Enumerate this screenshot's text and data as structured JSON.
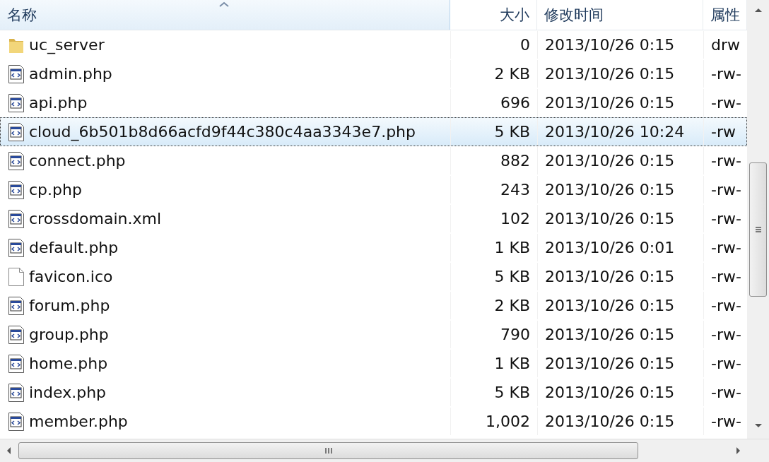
{
  "table": {
    "columns": [
      {
        "label": "名称",
        "sorted": true
      },
      {
        "label": "大小",
        "sorted": false
      },
      {
        "label": "修改时间",
        "sorted": false
      },
      {
        "label": "属性",
        "sorted": false
      }
    ],
    "rows": [
      {
        "kind": "folder",
        "name": "uc_server",
        "size": "0",
        "modified": "2013/10/26 0:15",
        "attributes": "drw",
        "selected": false
      },
      {
        "kind": "script",
        "name": "admin.php",
        "size": "2 KB",
        "modified": "2013/10/26 0:15",
        "attributes": "-rw-",
        "selected": false
      },
      {
        "kind": "script",
        "name": "api.php",
        "size": "696",
        "modified": "2013/10/26 0:15",
        "attributes": "-rw-",
        "selected": false
      },
      {
        "kind": "script",
        "name": "cloud_6b501b8d66acfd9f44c380c4aa3343e7.php",
        "size": "5 KB",
        "modified": "2013/10/26 10:24",
        "attributes": "-rw",
        "selected": true
      },
      {
        "kind": "script",
        "name": "connect.php",
        "size": "882",
        "modified": "2013/10/26 0:15",
        "attributes": "-rw-",
        "selected": false
      },
      {
        "kind": "script",
        "name": "cp.php",
        "size": "243",
        "modified": "2013/10/26 0:15",
        "attributes": "-rw-",
        "selected": false
      },
      {
        "kind": "script",
        "name": "crossdomain.xml",
        "size": "102",
        "modified": "2013/10/26 0:15",
        "attributes": "-rw-",
        "selected": false
      },
      {
        "kind": "script",
        "name": "default.php",
        "size": "1 KB",
        "modified": "2013/10/26 0:01",
        "attributes": "-rw-",
        "selected": false
      },
      {
        "kind": "file",
        "name": "favicon.ico",
        "size": "5 KB",
        "modified": "2013/10/26 0:15",
        "attributes": "-rw-",
        "selected": false
      },
      {
        "kind": "script",
        "name": "forum.php",
        "size": "2 KB",
        "modified": "2013/10/26 0:15",
        "attributes": "-rw-",
        "selected": false
      },
      {
        "kind": "script",
        "name": "group.php",
        "size": "790",
        "modified": "2013/10/26 0:15",
        "attributes": "-rw-",
        "selected": false
      },
      {
        "kind": "script",
        "name": "home.php",
        "size": "1 KB",
        "modified": "2013/10/26 0:15",
        "attributes": "-rw-",
        "selected": false
      },
      {
        "kind": "script",
        "name": "index.php",
        "size": "5 KB",
        "modified": "2013/10/26 0:15",
        "attributes": "-rw-",
        "selected": false
      },
      {
        "kind": "script",
        "name": "member.php",
        "size": "1,002",
        "modified": "2013/10/26 0:15",
        "attributes": "-rw-",
        "selected": false
      }
    ]
  }
}
